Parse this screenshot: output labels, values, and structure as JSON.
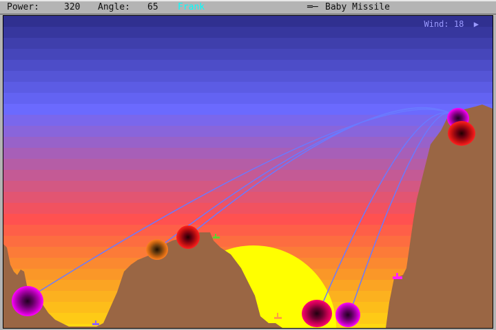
{
  "status_bar": {
    "power_label": "Power:",
    "power_value": "320",
    "angle_label": "Angle:",
    "angle_value": "65",
    "player_name": "Frank",
    "player_color": "#00ffff",
    "weapon_icon": "missile-icon",
    "weapon_name": "Baby Missile"
  },
  "hud": {
    "wind_label": "Wind:",
    "wind_value": "18",
    "wind_direction": "right"
  },
  "colors": {
    "terrain": "#9a6644",
    "sun": "#ffff00",
    "trajectory": "#6a7aff"
  }
}
